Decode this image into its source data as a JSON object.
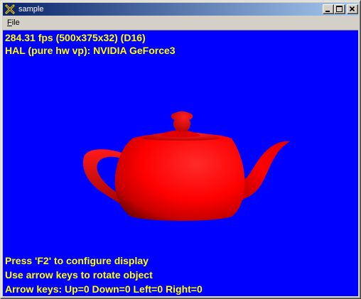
{
  "window": {
    "title": "sample",
    "title_icon": "directx-x-icon"
  },
  "menu": {
    "file_underlined": "F",
    "file_rest": "ile"
  },
  "viewport": {
    "background_color": "#0000ff",
    "text_color": "#ffff00",
    "stats_line": "284.31 fps (500x375x32) (D16)",
    "device_line": "HAL (pure hw vp): NVIDIA GeForce3",
    "help_lines": [
      "Press 'F2' to configure display",
      "Use arrow keys to rotate object",
      "Arrow keys: Up=0 Down=0 Left=0 Right=0"
    ],
    "object": "red-teapot",
    "object_color": "#ff0000"
  }
}
